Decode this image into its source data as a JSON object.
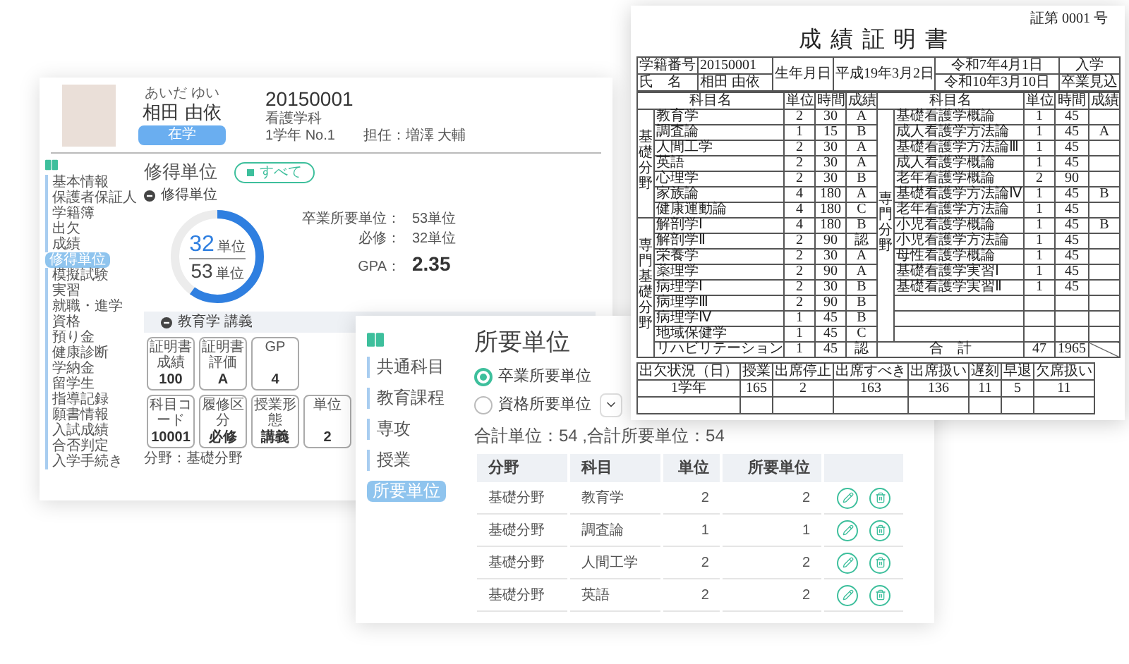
{
  "student_panel": {
    "student": {
      "furigana": "あいだ ゆい",
      "name": "相田 由依",
      "status": "在学",
      "id": "20150001",
      "department": "看護学科",
      "grade": "1学年 No.1",
      "homeroom": "担任：増澤 大輔"
    },
    "sidebar": {
      "items": [
        {
          "label": "基本情報",
          "selected": false
        },
        {
          "label": "保護者保証人",
          "selected": false
        },
        {
          "label": "学籍簿",
          "selected": false
        },
        {
          "label": "出欠",
          "selected": false
        },
        {
          "label": "成績",
          "selected": false
        },
        {
          "label": "修得単位",
          "selected": true
        },
        {
          "label": "模擬試験",
          "selected": false
        },
        {
          "label": "実習",
          "selected": false
        },
        {
          "label": "就職・進学",
          "selected": false
        },
        {
          "label": "資格",
          "selected": false
        },
        {
          "label": "預り金",
          "selected": false
        },
        {
          "label": "健康診断",
          "selected": false
        },
        {
          "label": "学納金",
          "selected": false
        },
        {
          "label": "留学生",
          "selected": false
        },
        {
          "label": "指導記録",
          "selected": false
        },
        {
          "label": "願書情報",
          "selected": false
        },
        {
          "label": "入試成績",
          "selected": false
        },
        {
          "label": "合否判定",
          "selected": false
        },
        {
          "label": "入学手続き",
          "selected": false
        }
      ]
    },
    "title": "修得単位",
    "filter_button": "すべて",
    "section_title": "修得単位",
    "donut": {
      "earned": "32",
      "earned_unit": "単位",
      "total": "53",
      "total_unit": "単位",
      "level": 0.6
    },
    "stats": [
      {
        "label": "卒業所要単位：",
        "value": "53単位",
        "kind": "plain"
      },
      {
        "label": "必修：",
        "value": "32単位",
        "kind": "plain"
      },
      {
        "label": "GPA：",
        "value": "2.35",
        "kind": "large"
      }
    ],
    "course_bar": "教育学 講義",
    "card_rows": [
      [
        {
          "label": "証明書成績",
          "value": "100"
        },
        {
          "label": "証明書評価",
          "value": "A"
        },
        {
          "label": "GP",
          "value": "4"
        }
      ],
      [
        {
          "label": "科目コード",
          "value": "10001"
        },
        {
          "label": "履修区分",
          "value": "必修"
        },
        {
          "label": "授業形態",
          "value": "講義"
        },
        {
          "label": "単位",
          "value": "2"
        }
      ]
    ],
    "field_note": "分野：基礎分野"
  },
  "certificate": {
    "number": "証第 0001 号",
    "title": "成績証明書",
    "info": {
      "id_label": "学籍番号",
      "id": "20150001",
      "name_label": "氏　名",
      "name": "相田 由依",
      "birth_label": "生年月日",
      "birth": "平成19年3月2日",
      "admission_date": "令和7年4月1日",
      "admission": "入学",
      "graduation_date": "令和10年3月10日",
      "graduation": "卒業見込"
    },
    "halves": [
      {
        "columns": [
          "科目名",
          "単位",
          "時間",
          "成績"
        ],
        "groups": [
          {
            "field": "基礎分野",
            "rows": [
              {
                "subject": "教育学",
                "units": "2",
                "hours": "30",
                "grade": "A"
              },
              {
                "subject": "調査論",
                "units": "1",
                "hours": "15",
                "grade": "B"
              },
              {
                "subject": "人間工学",
                "units": "2",
                "hours": "30",
                "grade": "A"
              },
              {
                "subject": "英語",
                "units": "2",
                "hours": "30",
                "grade": "A"
              },
              {
                "subject": "心理学",
                "units": "2",
                "hours": "30",
                "grade": "B"
              },
              {
                "subject": "家族論",
                "units": "4",
                "hours": "180",
                "grade": "A"
              },
              {
                "subject": "健康運動論",
                "units": "4",
                "hours": "180",
                "grade": "C"
              }
            ]
          },
          {
            "field": "専門基礎分野",
            "rows": [
              {
                "subject": "解剖学Ⅰ",
                "units": "4",
                "hours": "180",
                "grade": "B"
              },
              {
                "subject": "解剖学Ⅱ",
                "units": "2",
                "hours": "90",
                "grade": "認"
              },
              {
                "subject": "栄養学",
                "units": "2",
                "hours": "30",
                "grade": "A"
              },
              {
                "subject": "薬理学",
                "units": "2",
                "hours": "90",
                "grade": "A"
              },
              {
                "subject": "病理学Ⅰ",
                "units": "2",
                "hours": "30",
                "grade": "B"
              },
              {
                "subject": "病理学Ⅲ",
                "units": "2",
                "hours": "90",
                "grade": "B"
              },
              {
                "subject": "病理学Ⅳ",
                "units": "1",
                "hours": "45",
                "grade": "B"
              },
              {
                "subject": "地域保健学",
                "units": "1",
                "hours": "45",
                "grade": "C"
              },
              {
                "subject": "リハビリテーション",
                "units": "1",
                "hours": "45",
                "grade": "認"
              }
            ]
          }
        ]
      },
      {
        "columns": [
          "科目名",
          "単位",
          "時間",
          "成績"
        ],
        "groups": [
          {
            "field": "専門分野",
            "rows": [
              {
                "subject": "基礎看護学概論",
                "units": "1",
                "hours": "45"
              },
              {
                "subject": "成人看護学方法論",
                "units": "1",
                "hours": "45",
                "grade": "A"
              },
              {
                "subject": "基礎看護学方法論Ⅲ",
                "units": "1",
                "hours": "45"
              },
              {
                "subject": "成人看護学概論",
                "units": "1",
                "hours": "45"
              },
              {
                "subject": "老年看護学概論",
                "units": "2",
                "hours": "90"
              },
              {
                "subject": "基礎看護学方法論Ⅳ",
                "units": "1",
                "hours": "45",
                "grade": "B"
              },
              {
                "subject": "老年看護学方法論",
                "units": "1",
                "hours": "45"
              },
              {
                "subject": "小児看護学概論",
                "units": "1",
                "hours": "45",
                "grade": "B"
              },
              {
                "subject": "小児看護学方法論",
                "units": "1",
                "hours": "45"
              },
              {
                "subject": "母性看護学概論",
                "units": "1",
                "hours": "45"
              },
              {
                "subject": "基礎看護学実習Ⅰ",
                "units": "1",
                "hours": "45"
              },
              {
                "subject": "基礎看護学実習Ⅱ",
                "units": "1",
                "hours": "45"
              }
            ]
          }
        ],
        "total": {
          "label": "合　計",
          "units": "47",
          "hours": "1965"
        }
      }
    ],
    "attendance": {
      "columns": [
        "出欠状況（日）",
        "授業",
        "出席停止",
        "出席すべき",
        "出席扱い",
        "遅刻",
        "早退",
        "欠席扱い"
      ],
      "rows": [
        [
          "1学年",
          "165",
          "2",
          "163",
          "136",
          "11",
          "5",
          "11"
        ]
      ]
    }
  },
  "requirements_panel": {
    "sidebar": {
      "items": [
        {
          "label": "共通科目",
          "selected": false
        },
        {
          "label": "教育課程",
          "selected": false
        },
        {
          "label": "専攻",
          "selected": false
        },
        {
          "label": "授業",
          "selected": false
        },
        {
          "label": "所要単位",
          "selected": true
        }
      ]
    },
    "title": "所要単位",
    "options": [
      {
        "label": "卒業所要単位",
        "selected": true,
        "dropdown": false
      },
      {
        "label": "資格所要単位",
        "selected": false,
        "dropdown": true
      }
    ],
    "summary": "合計単位：54 ,合計所要単位：54",
    "table": {
      "columns": [
        "分野",
        "科目",
        "単位",
        "所要単位"
      ],
      "rows": [
        {
          "field": "基礎分野",
          "subject": "教育学",
          "units": "2",
          "required": "2"
        },
        {
          "field": "基礎分野",
          "subject": "調査論",
          "units": "1",
          "required": "1"
        },
        {
          "field": "基礎分野",
          "subject": "人間工学",
          "units": "2",
          "required": "2"
        },
        {
          "field": "基礎分野",
          "subject": "英語",
          "units": "2",
          "required": "2"
        }
      ]
    }
  }
}
